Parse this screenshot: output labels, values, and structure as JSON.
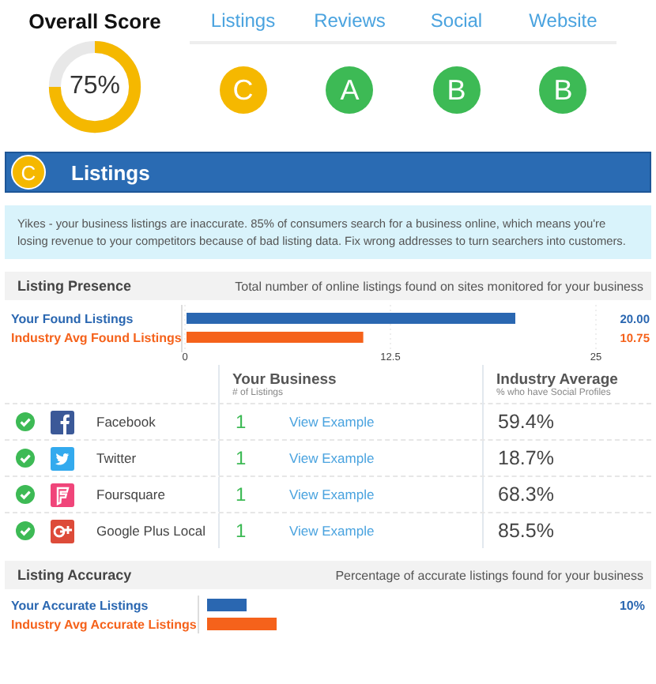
{
  "overall": {
    "title": "Overall Score",
    "score": "75%"
  },
  "categories": [
    {
      "label": "Listings",
      "grade": "C",
      "color": "#f5b800"
    },
    {
      "label": "Reviews",
      "grade": "A",
      "color": "#3dba55"
    },
    {
      "label": "Social",
      "grade": "B",
      "color": "#3dba55"
    },
    {
      "label": "Website",
      "grade": "B",
      "color": "#3dba55"
    }
  ],
  "section": {
    "grade": "C",
    "color": "#f5b800",
    "title": "Listings"
  },
  "alert": "Yikes - your business listings are inaccurate. 85% of consumers search for a business online, which means you're losing revenue to your competitors because of bad listing data. Fix wrong addresses to turn searchers into customers.",
  "presence": {
    "title": "Listing Presence",
    "description": "Total number of online listings found on sites monitored for your business",
    "chart_data": {
      "type": "bar",
      "orientation": "horizontal",
      "categories": [
        "Your Found Listings",
        "Industry Avg Found Listings"
      ],
      "series": [
        {
          "colors": [
            "#2a67b1",
            "#f5621b"
          ],
          "values": [
            20,
            10.75
          ]
        }
      ],
      "xlim": [
        0,
        25
      ],
      "xticks": [
        {
          "value": 0,
          "label": "0"
        },
        {
          "value": 12.5,
          "label": "12.5"
        },
        {
          "value": 25,
          "label": "25"
        }
      ],
      "value_labels": [
        "20.00",
        "10.75"
      ]
    }
  },
  "table": {
    "columns": [
      {
        "title": "Your Business",
        "subtitle": "# of Listings"
      },
      {
        "title": "Industry Average",
        "subtitle": "% who have Social Profiles"
      }
    ],
    "rows": [
      {
        "kind": "facebook",
        "found": true,
        "name": "Facebook",
        "count": "1",
        "link": "View Example",
        "average": "59.4%"
      },
      {
        "kind": "twitter",
        "found": true,
        "name": "Twitter",
        "count": "1",
        "link": "View Example",
        "average": "18.7%"
      },
      {
        "kind": "foursquare",
        "found": true,
        "name": "Foursquare",
        "count": "1",
        "link": "View Example",
        "average": "68.3%"
      },
      {
        "kind": "googleplus",
        "found": true,
        "name": "Google Plus Local",
        "count": "1",
        "link": "View Example",
        "average": "85.5%"
      }
    ]
  },
  "accuracy": {
    "title": "Listing Accuracy",
    "description": "Percentage of accurate listings found for your business",
    "rows": [
      {
        "label": "Your Accurate Listings",
        "color": "#2a67b1",
        "level": 0.1,
        "value": "10%"
      },
      {
        "label": "Industry Avg Accurate Listings",
        "color": "#f5621b",
        "level": 0.18
      }
    ]
  }
}
